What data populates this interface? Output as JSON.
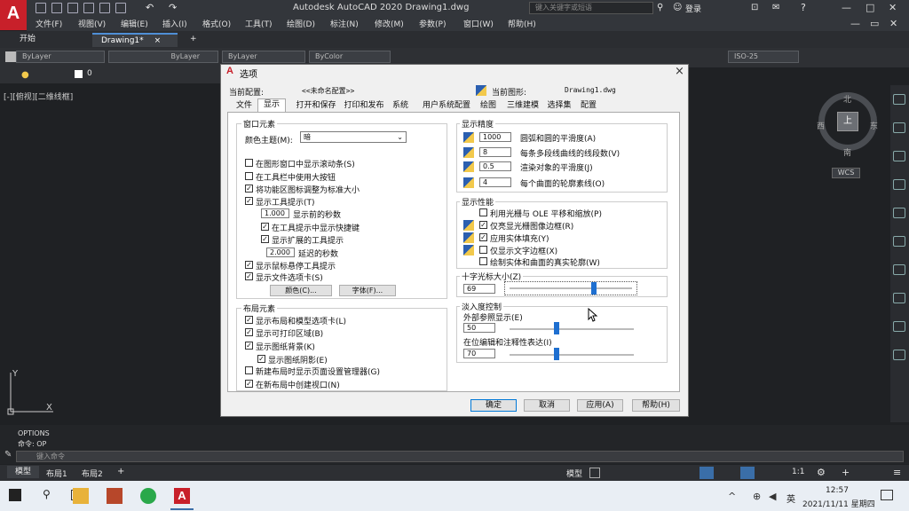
{
  "titlebar": {
    "app_title": "Autodesk AutoCAD 2020    Drawing1.dwg",
    "search_placeholder": "键入关键字或短语",
    "login": "登录"
  },
  "menu": [
    "文件(F)",
    "视图(V)",
    "编辑(E)",
    "插入(I)",
    "格式(O)",
    "工具(T)",
    "绘图(D)",
    "标注(N)",
    "修改(M)",
    "参数(P)",
    "窗口(W)",
    "帮助(H)"
  ],
  "tabs": {
    "start": "开始",
    "drawing": "Drawing1*",
    "close": "×",
    "add": "+"
  },
  "toolbar": {
    "layer1": "ByLayer",
    "layer2": "ByLayer",
    "layer3": "ByLayer",
    "color": "ByColor",
    "dimstyle": "ISO-25",
    "layer_num": "0"
  },
  "viewport": {
    "label": "[-][俯视][二维线框]",
    "compass": {
      "n": "北",
      "s": "南",
      "e": "东",
      "w": "西",
      "top": "上"
    },
    "wcs": "WCS"
  },
  "command": {
    "line1": "OPTIONS",
    "line2": "命令: OP",
    "placeholder": "键入命令"
  },
  "status": {
    "model_tab": "模型",
    "layout1": "布局1",
    "layout2": "布局2",
    "add": "+",
    "model": "模型",
    "scale": "1:1"
  },
  "taskbar": {
    "time": "12:57",
    "date": "2021/11/11 星期四",
    "lang": "英"
  },
  "dialog": {
    "title": "选项",
    "close": "×",
    "current_profile_label": "当前配置:",
    "current_profile": "<<未命名配置>>",
    "current_drawing_label": "当前图形:",
    "current_drawing": "Drawing1.dwg",
    "tabs": [
      "文件",
      "显示",
      "打开和保存",
      "打印和发布",
      "系统",
      "用户系统配置",
      "绘图",
      "三维建模",
      "选择集",
      "配置"
    ],
    "window_elements": {
      "title": "窗口元素",
      "color_theme_label": "颜色主题(M):",
      "color_theme": "暗",
      "scrollbars": "在图形窗口中显示滚动条(S)",
      "large_buttons": "在工具栏中使用大按钮",
      "resize_icons": "将功能区图标调整为标准大小",
      "tooltips": "显示工具提示(T)",
      "delay1_value": "1.000",
      "delay1_label": "显示前的秒数",
      "shortcut_keys": "在工具提示中显示快捷键",
      "extended_tips": "显示扩展的工具提示",
      "delay2_value": "2.000",
      "delay2_label": "延迟的秒数",
      "rollover": "显示鼠标悬停工具提示",
      "file_tabs": "显示文件选项卡(S)",
      "colors_button": "颜色(C)...",
      "fonts_button": "字体(F)..."
    },
    "layout_elements": {
      "title": "布局元素",
      "layout_tabs": "显示布局和模型选项卡(L)",
      "printable_area": "显示可打印区域(B)",
      "paper_background": "显示图纸背景(K)",
      "paper_shadow": "显示图纸阴影(E)",
      "page_setup": "新建布局时显示页面设置管理器(G)",
      "create_viewport": "在新布局中创建视口(N)"
    },
    "resolution": {
      "title": "显示精度",
      "arc_value": "1000",
      "arc_label": "圆弧和圆的平滑度(A)",
      "poly_value": "8",
      "poly_label": "每条多段线曲线的线段数(V)",
      "render_value": "0.5",
      "render_label": "渲染对象的平滑度(J)",
      "contour_value": "4",
      "contour_label": "每个曲面的轮廓素线(O)"
    },
    "performance": {
      "title": "显示性能",
      "raster_ole": "利用光栅与 OLE 平移和缩放(P)",
      "highlight_raster": "仅亮显光栅图像边框(R)",
      "solid_fill": "应用实体填充(Y)",
      "text_boundary": "仅显示文字边框(X)",
      "silhouettes": "绘制实体和曲面的真实轮廓(W)"
    },
    "crosshair": {
      "title": "十字光标大小(Z)",
      "value": "69",
      "percent": 69
    },
    "fade": {
      "title": "淡入度控制",
      "xref_label": "外部参照显示(E)",
      "xref_value": "50",
      "xref_percent": 50,
      "inplace_label": "在位编辑和注释性表达(I)",
      "inplace_value": "70",
      "inplace_percent": 70
    },
    "buttons": {
      "ok": "确定",
      "cancel": "取消",
      "apply": "应用(A)",
      "help": "帮助(H)"
    }
  },
  "colors": {
    "accent": "#1e6fd0",
    "logo": "#c8202a"
  }
}
